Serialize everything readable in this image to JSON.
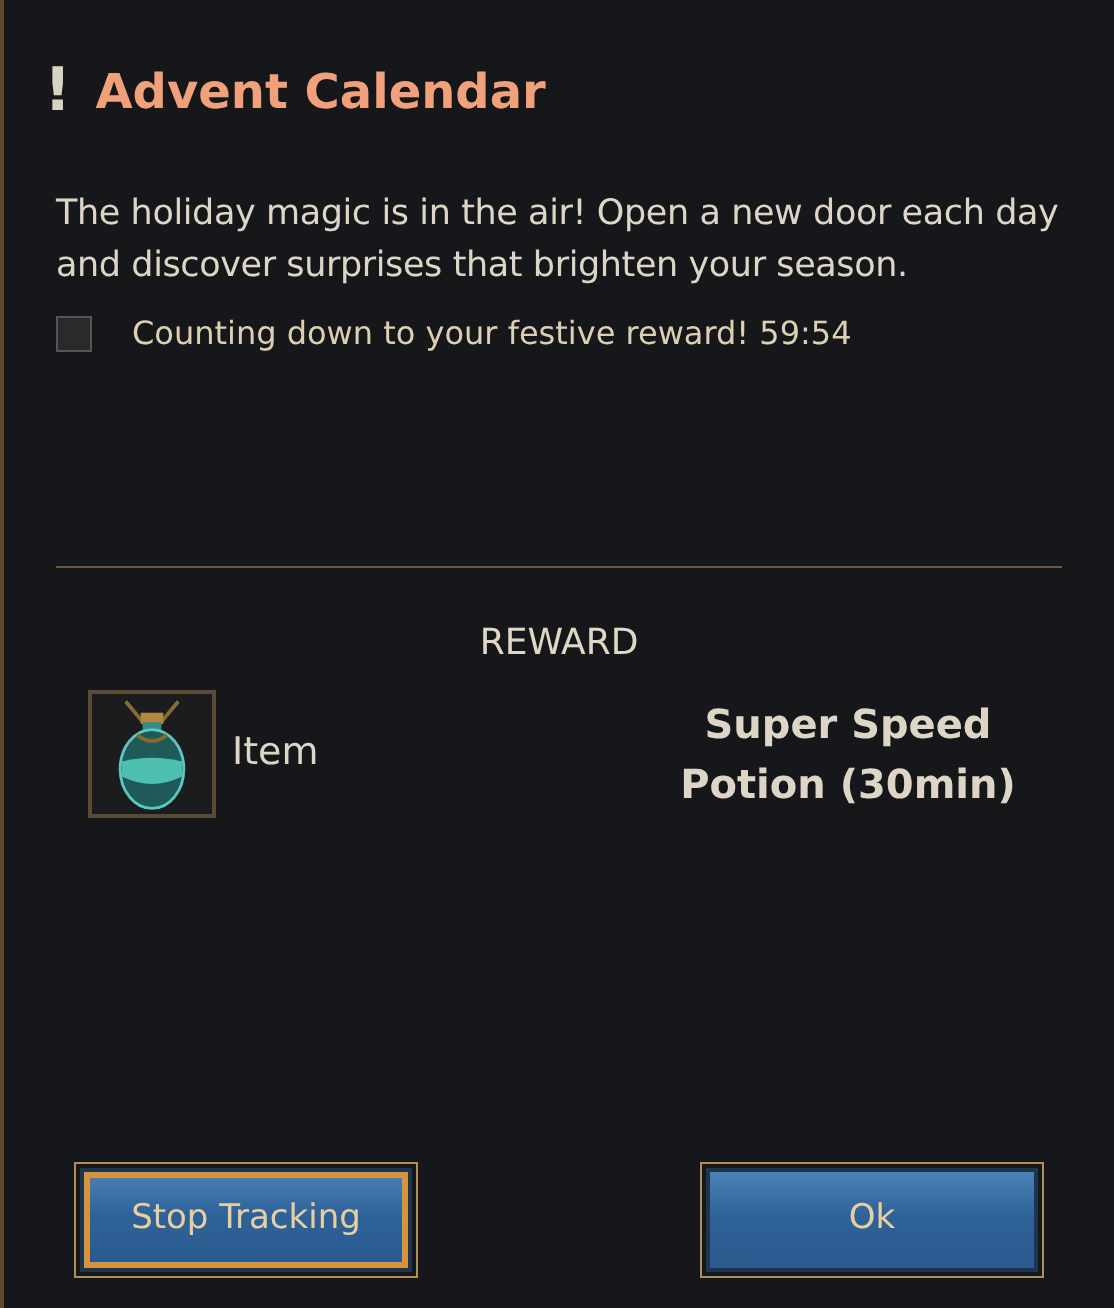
{
  "dialog": {
    "title_mark": "!",
    "title": "Advent Calendar",
    "description": "The holiday magic is in the air! Open a new door each day and discover surprises that brighten your season.",
    "tracker": {
      "checked": false,
      "label": "Counting down to your festive reward! 59:54"
    },
    "reward": {
      "heading": "REWARD",
      "type_label": "Item",
      "name": "Super Speed Potion (30min)"
    },
    "buttons": [
      {
        "label": "Stop Tracking",
        "selected": true
      },
      {
        "label": "Ok",
        "selected": false
      }
    ]
  }
}
